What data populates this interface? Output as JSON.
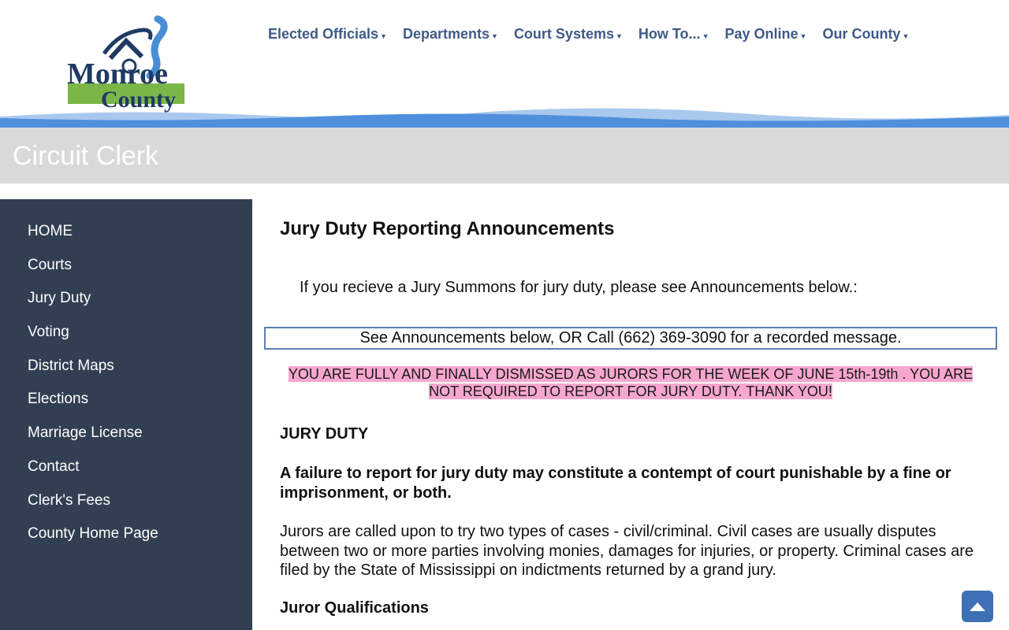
{
  "logo": {
    "line1": "Monroe",
    "line2": "County"
  },
  "topnav": [
    {
      "label": "Elected Officials"
    },
    {
      "label": "Departments"
    },
    {
      "label": "Court Systems"
    },
    {
      "label": "How To..."
    },
    {
      "label": "Pay Online"
    },
    {
      "label": "Our County"
    }
  ],
  "page_title": "Circuit Clerk",
  "sidebar": {
    "items": [
      {
        "label": "HOME"
      },
      {
        "label": "Courts"
      },
      {
        "label": "Jury Duty"
      },
      {
        "label": "Voting"
      },
      {
        "label": "District Maps"
      },
      {
        "label": "Elections"
      },
      {
        "label": "Marriage License"
      },
      {
        "label": "Contact"
      },
      {
        "label": "Clerk's Fees"
      },
      {
        "label": "County Home Page"
      }
    ]
  },
  "main": {
    "heading": "Jury Duty Reporting Announcements",
    "intro": "If you recieve a Jury Summons for jury duty, please see Announcements below.:",
    "callbox": "See Announcements below, OR Call (662) 369-3090 for a recorded message.",
    "dismiss_line1": "YOU ARE FULLY AND FINALLY DISMISSED AS JURORS FOR THE WEEK OF JUNE 15th-19th . YOU ARE",
    "dismiss_line2": "NOT REQUIRED TO REPORT FOR JURY DUTY. THANK YOU!",
    "jury_duty_heading": "JURY DUTY",
    "warning": "A failure to report for jury duty may constitute a contempt of court punishable by a fine or imprisonment, or both.",
    "cases_paragraph": "Jurors are called upon to try two types of cases - civil/criminal. Civil cases are usually disputes between two or more parties involving monies, damages for injuries, or property. Criminal cases are filed by the State of Mississippi on indictments returned by a grand jury.",
    "qualifications_heading": "Juror Qualifications"
  },
  "colors": {
    "nav_text": "#3e5a86",
    "sidebar_bg": "#323f52",
    "title_bar_bg": "#d9d9d9",
    "wave_blue": "#4f8fdc",
    "highlight_pink": "#f7a7cf",
    "logo_green": "#7ab648"
  },
  "icons": {
    "back_to_top": "chevron-up-icon"
  }
}
